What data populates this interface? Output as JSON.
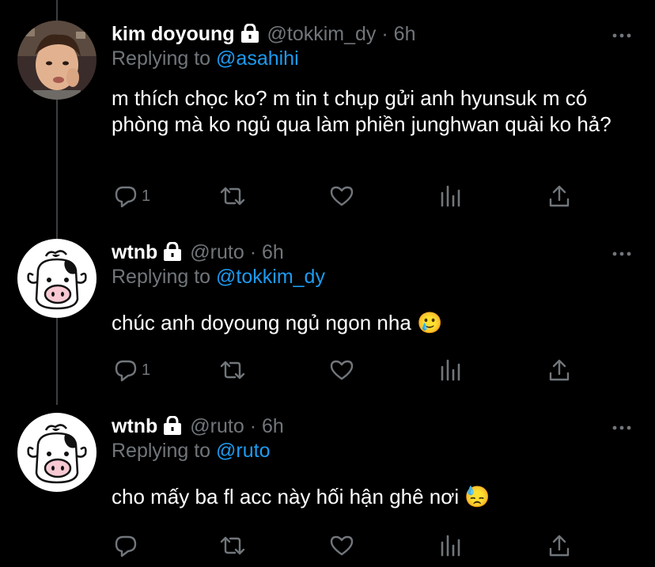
{
  "colors": {
    "background": "#000000",
    "text": "#ffffff",
    "muted": "#71767b",
    "mention": "#1d9bf0",
    "thread_line": "#3b3f43"
  },
  "tweets": [
    {
      "name": "kim doyoung",
      "handle": "@tokkim_dy",
      "separator": "·",
      "time": "6h",
      "replying_prefix": "Replying to",
      "replying_to": "@asahihi",
      "text": "m thích chọc ko? m tin t chụp gửi anh hyunsuk m có phòng mà ko ngủ qua làm phiền junghwan quài ko hả?",
      "reply_count": "1",
      "avatar": "person-photo-avatar",
      "verified_icon": "lock-icon"
    },
    {
      "name": "wtnb",
      "handle": "@ruto",
      "separator": "·",
      "time": "6h",
      "replying_prefix": "Replying to",
      "replying_to": "@tokkim_dy",
      "text": "chúc anh doyoung ngủ ngon nha 🥲",
      "reply_count": "1",
      "avatar": "cow-cartoon-avatar",
      "verified_icon": "lock-icon"
    },
    {
      "name": "wtnb",
      "handle": "@ruto",
      "separator": "·",
      "time": "6h",
      "replying_prefix": "Replying to",
      "replying_to": "@ruto",
      "text": "cho mấy ba fl acc này hối hận ghê nơi 😓",
      "reply_count": "",
      "avatar": "cow-cartoon-avatar",
      "verified_icon": "lock-icon"
    }
  ]
}
